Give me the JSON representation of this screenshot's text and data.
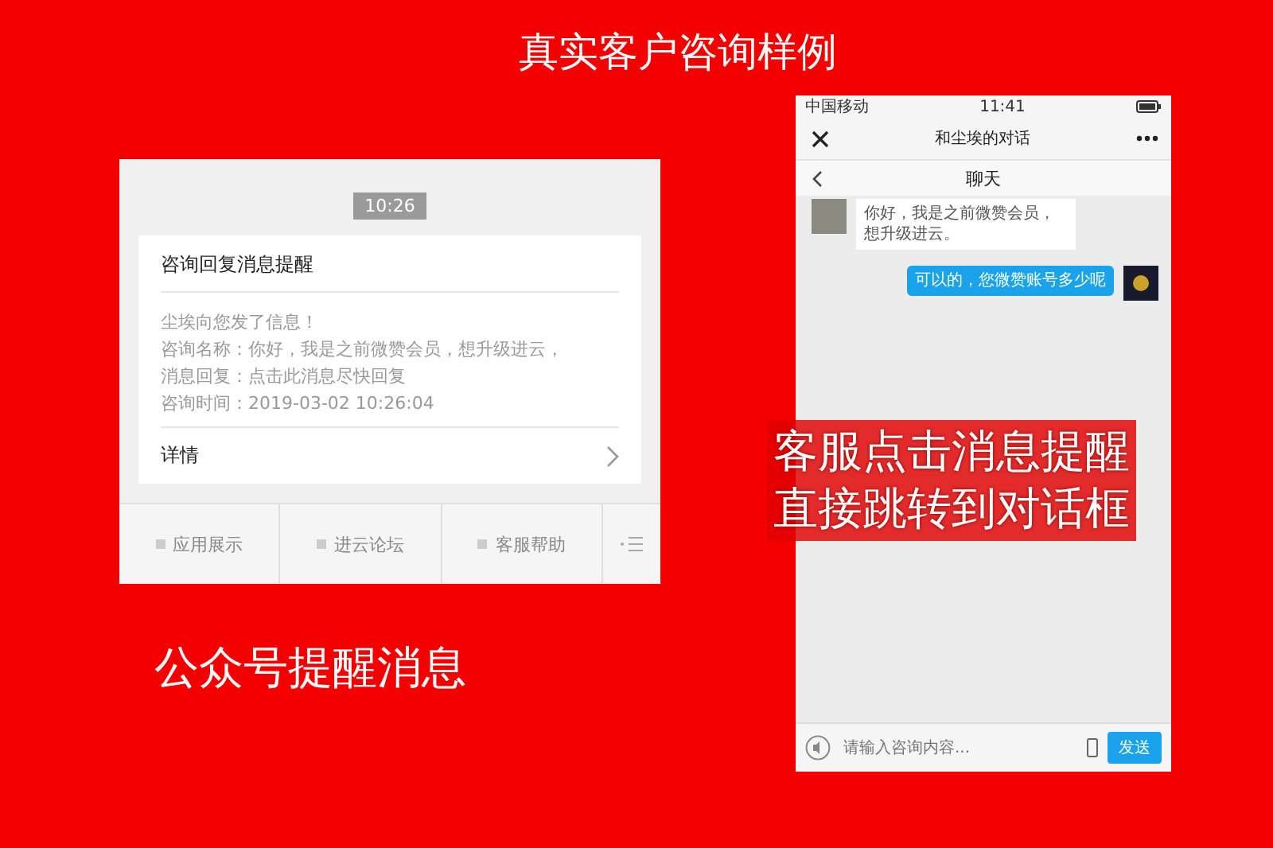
{
  "headline": "真实客户咨询样例",
  "notification_panel": {
    "time": "10:26",
    "card": {
      "title": "咨询回复消息提醒",
      "lines": [
        "尘埃向您发了信息！",
        "咨询名称：你好，我是之前微赞会员，想升级进云，",
        "消息回复：点击此消息尽快回复",
        "咨询时间：2019-03-02 10:26:04"
      ],
      "details": "详情"
    },
    "menu": [
      {
        "label": "应用展示"
      },
      {
        "label": "进云论坛"
      },
      {
        "label": "客服帮助"
      }
    ]
  },
  "caption": "公众号提醒消息",
  "phone": {
    "status_bar": {
      "carrier": "中国移动",
      "time": "11:41"
    },
    "nav_title": "和尘埃的对话",
    "sub_title": "聊天",
    "messages": [
      {
        "kind": "incoming",
        "text": "你好，我是之前微赞会员，想升级进云。"
      },
      {
        "kind": "outgoing",
        "text": "可以的，您微赞账号多少呢"
      }
    ],
    "input": {
      "placeholder": "请输入咨询内容..."
    },
    "send_button": "发送"
  },
  "overlay_caption": [
    "客服点击消息提醒",
    "直接跳转到对话框"
  ]
}
